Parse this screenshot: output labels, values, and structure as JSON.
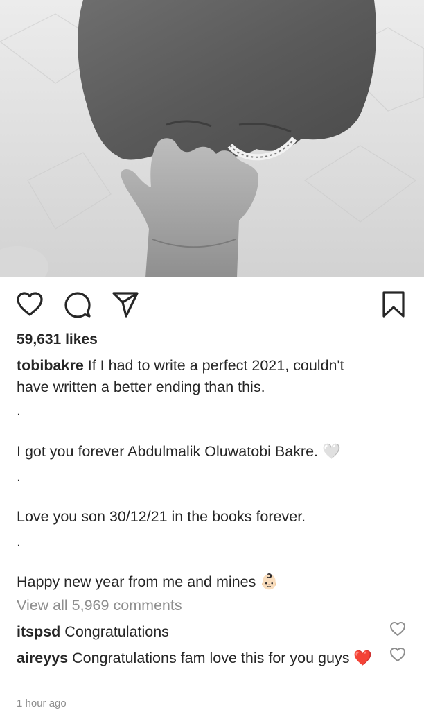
{
  "post": {
    "image_alt": "",
    "likes": "59,631 likes",
    "username": "tobibakre",
    "caption_line1": " If I had to write a perfect 2021, couldn't",
    "caption_line2": "have written a better ending than this.",
    "dot": ".",
    "caption_line3": "I got you forever Abdulmalik Oluwatobi Bakre. 🤍",
    "caption_line4": "Love you son 30/12/21 in the books forever.",
    "caption_line5": "Happy new year from me and mines 👶🏻",
    "view_all_comments": "View all 5,969 comments",
    "comments": [
      {
        "user": "itspsd",
        "text": " Congratulations"
      },
      {
        "user": "aireyys",
        "text": " Congratulations fam love this for you guys ❤️"
      }
    ],
    "timestamp": "1 hour ago"
  },
  "icons": {
    "like": "heart-outline-icon",
    "comment": "comment-bubble-icon",
    "share": "paper-plane-icon",
    "save": "bookmark-icon",
    "comment_like": "small-heart-icon"
  },
  "colors": {
    "text": "#262626",
    "muted": "#8e8e8e",
    "background": "#ffffff"
  }
}
